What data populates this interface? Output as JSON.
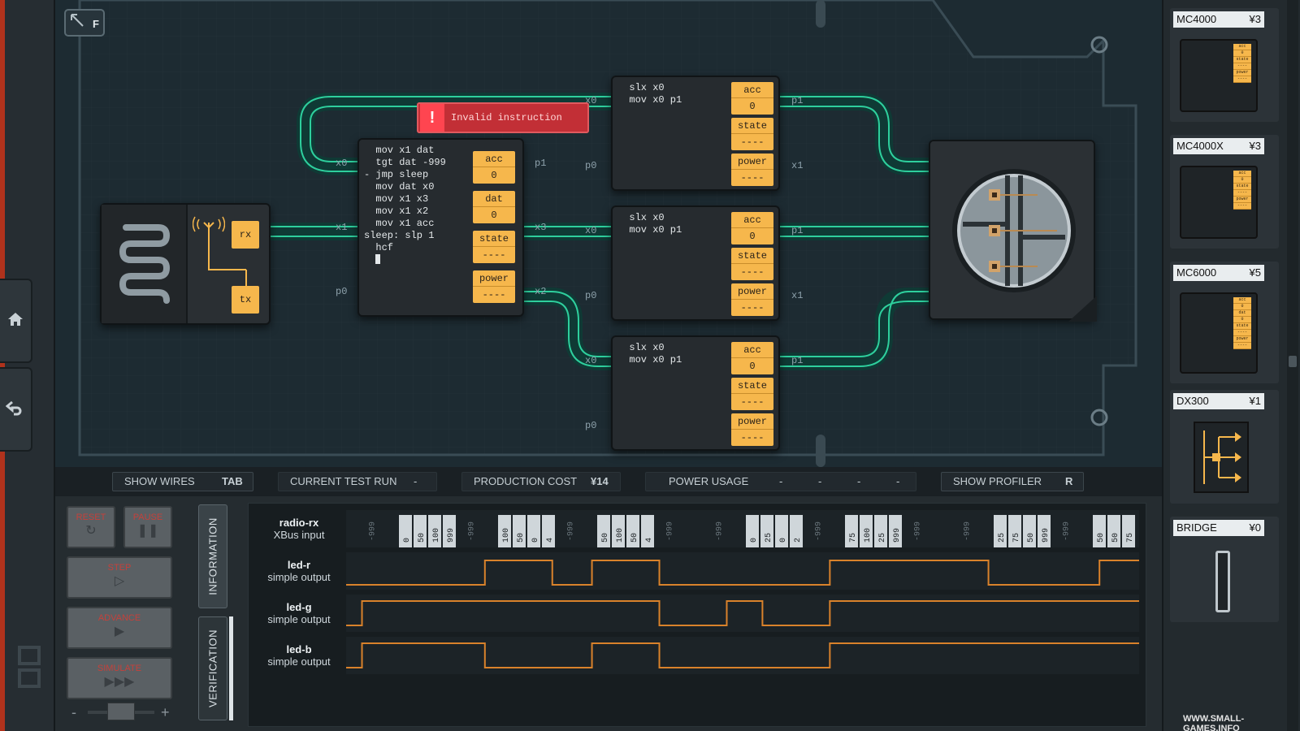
{
  "board": {
    "fullscreen_key": "F",
    "error_message": "Invalid instruction",
    "radio": {
      "rx_label": "rx",
      "tx_label": "tx"
    },
    "main_chip": {
      "code": "  mov x1 dat\n  tgt dat -999\n- jmp sleep\n  mov dat x0\n  mov x1 x3\n  mov x1 x2\n  mov x1 acc\nsleep: slp 1\n  hcf",
      "pins": {
        "left_top": "x0",
        "left_mid": "x1",
        "left_bot": "p0",
        "right_top": "p1",
        "right_mid": "x3",
        "right_bot": "x2"
      },
      "registers": [
        {
          "name": "acc",
          "value": "0"
        },
        {
          "name": "dat",
          "value": "0"
        },
        {
          "name": "state",
          "value": "----"
        },
        {
          "name": "power",
          "value": "----"
        }
      ]
    },
    "small_chips": [
      {
        "code": "  slx x0\n  mov x0 p1",
        "pins": {
          "left_top": "x0",
          "left_bot": "p0",
          "right_top": "p1",
          "right_bot": "x1"
        },
        "registers": [
          {
            "name": "acc",
            "value": "0"
          },
          {
            "name": "state",
            "value": "----"
          },
          {
            "name": "power",
            "value": "----"
          }
        ]
      },
      {
        "code": "  slx x0\n  mov x0 p1",
        "pins": {
          "left_top": "x0",
          "left_bot": "p0",
          "right_top": "p1",
          "right_bot": "x1"
        },
        "registers": [
          {
            "name": "acc",
            "value": "0"
          },
          {
            "name": "state",
            "value": "----"
          },
          {
            "name": "power",
            "value": "----"
          }
        ]
      },
      {
        "code": "  slx x0\n  mov x0 p1",
        "pins": {
          "left_top": "x0",
          "left_bot": "p0",
          "right_top": "p1",
          "right_bot": ""
        },
        "registers": [
          {
            "name": "acc",
            "value": "0"
          },
          {
            "name": "state",
            "value": "----"
          },
          {
            "name": "power",
            "value": "----"
          }
        ]
      }
    ]
  },
  "status_bar": {
    "show_wires": {
      "label": "SHOW WIRES",
      "key": "TAB"
    },
    "current_test_run": {
      "label": "CURRENT TEST RUN",
      "value": "-"
    },
    "production_cost": {
      "label": "PRODUCTION COST",
      "value": "¥14"
    },
    "power_usage": {
      "label": "POWER USAGE",
      "values": [
        "-",
        "-",
        "-",
        "-"
      ]
    },
    "show_profiler": {
      "label": "SHOW PROFILER",
      "key": "R"
    }
  },
  "controls": {
    "reset": "RESET",
    "pause": "PAUSE",
    "step": "STEP",
    "advance": "ADVANCE",
    "simulate": "SIMULATE",
    "speed_minus": "-",
    "speed_plus": "+"
  },
  "tabs": {
    "information": "INFORMATION",
    "verification": "VERIFICATION"
  },
  "timeline": {
    "rows": [
      {
        "name": "radio-rx",
        "type": "XBus input"
      },
      {
        "name": "led-r",
        "type": "simple output"
      },
      {
        "name": "led-g",
        "type": "simple output"
      },
      {
        "name": "led-b",
        "type": "simple output"
      }
    ],
    "radio_packets": [
      {
        "kind": "idle",
        "values": [
          "-999"
        ]
      },
      {
        "kind": "packet",
        "values": [
          "0",
          "50",
          "100",
          "999"
        ]
      },
      {
        "kind": "idle",
        "values": [
          "-999"
        ]
      },
      {
        "kind": "packet",
        "values": [
          "100",
          "50",
          "0",
          "4"
        ]
      },
      {
        "kind": "idle",
        "values": [
          "-999"
        ]
      },
      {
        "kind": "packet",
        "values": [
          "50",
          "100",
          "50",
          "4"
        ]
      },
      {
        "kind": "idle",
        "values": [
          "-999"
        ]
      },
      {
        "kind": "idle",
        "values": [
          "-999"
        ]
      },
      {
        "kind": "packet",
        "values": [
          "0",
          "25",
          "0",
          "2"
        ]
      },
      {
        "kind": "idle",
        "values": [
          "-999"
        ]
      },
      {
        "kind": "packet",
        "values": [
          "75",
          "100",
          "25",
          "999"
        ]
      },
      {
        "kind": "idle",
        "values": [
          "-999"
        ]
      },
      {
        "kind": "idle",
        "values": [
          "-999"
        ]
      },
      {
        "kind": "packet",
        "values": [
          "25",
          "75",
          "50",
          "999"
        ]
      },
      {
        "kind": "idle",
        "values": [
          "-999"
        ]
      },
      {
        "kind": "packet",
        "values": [
          "50",
          "50",
          "75"
        ]
      }
    ]
  },
  "parts": [
    {
      "name": "MC4000",
      "cost": "¥3",
      "mini_registers": [
        "acc",
        "0",
        "state",
        "----",
        "power",
        "----"
      ]
    },
    {
      "name": "MC4000X",
      "cost": "¥3",
      "mini_registers": [
        "acc",
        "0",
        "state",
        "----",
        "power",
        "----"
      ]
    },
    {
      "name": "MC6000",
      "cost": "¥5",
      "mini_registers": [
        "acc",
        "0",
        "dat",
        "0",
        "state",
        "----",
        "power",
        "----"
      ]
    },
    {
      "name": "DX300",
      "cost": "¥1"
    },
    {
      "name": "BRIDGE",
      "cost": "¥0"
    }
  ],
  "watermark": "WWW.SMALL-GAMES.INFO",
  "colors": {
    "register": "#f6b74c",
    "wire": "#2ecf9d",
    "signal": "#d9822b",
    "error": "#c22f36",
    "rail_edge": "#b0321c"
  },
  "icons": [
    "fullscreen-icon",
    "home-icon",
    "undo-icon",
    "reset-icon",
    "pause-icon",
    "step-icon",
    "advance-icon",
    "simulate-icon",
    "antenna-icon",
    "coil-icon",
    "led-icon",
    "error-icon"
  ]
}
